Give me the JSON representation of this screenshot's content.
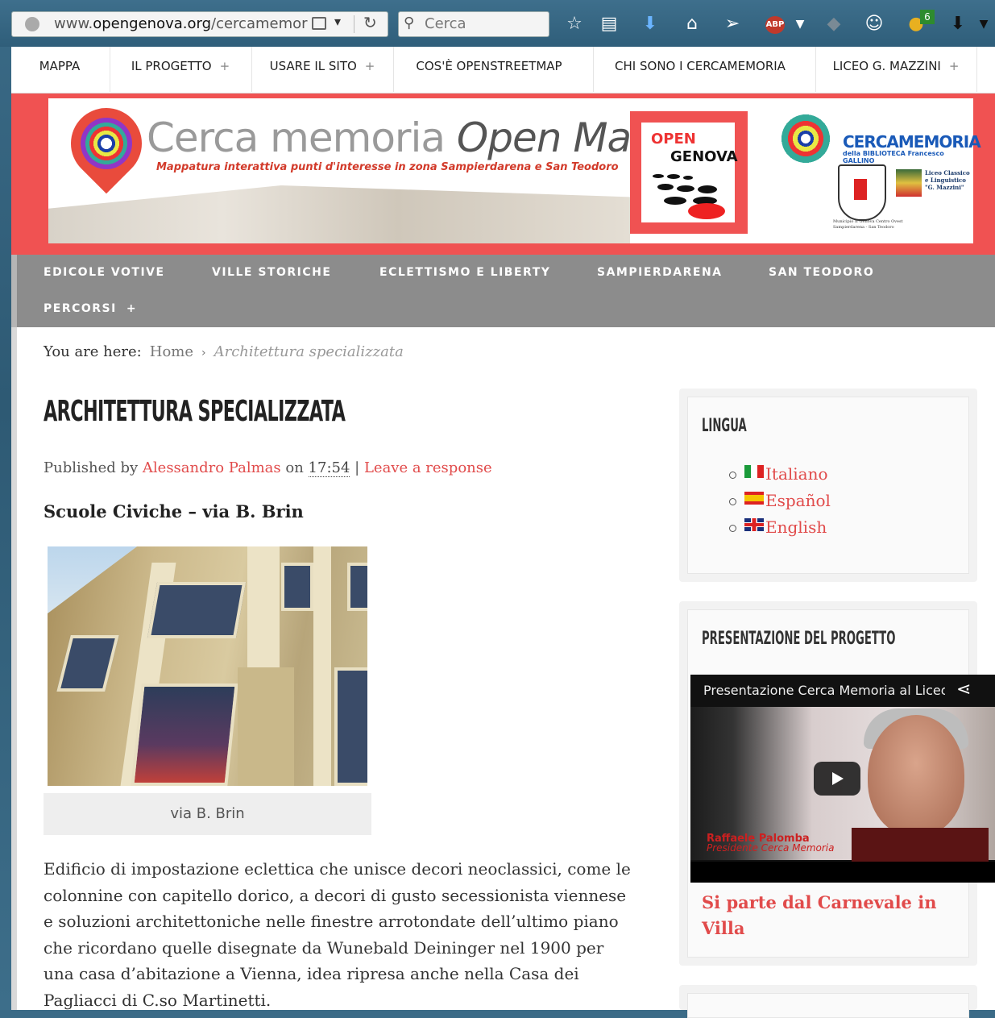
{
  "browser": {
    "url_prefix": "www.",
    "url_domain": "opengenova.org",
    "url_path": "/cercamemor",
    "search_placeholder": "Cerca",
    "abp_label": "ABP",
    "badge_count": "6"
  },
  "topnav": {
    "items": [
      {
        "label": "MAPPA",
        "plus": ""
      },
      {
        "label": "IL PROGETTO",
        "plus": "+"
      },
      {
        "label": "USARE IL SITO",
        "plus": "+"
      },
      {
        "label": "COS'È OPENSTREETMAP",
        "plus": ""
      },
      {
        "label": "CHI SONO I CERCAMEMORIA",
        "plus": ""
      },
      {
        "label": "LICEO G. MAZZINI",
        "plus": "+"
      }
    ]
  },
  "banner": {
    "title_a": "Cerca memoria ",
    "title_b": "Open Map",
    "subtitle": "Mappatura interattiva punti d'interesse in zona Sampierdarena e San Teodoro",
    "og_open": "OPEN",
    "og_genova": "GENOVA",
    "cm_name": "CERCAMEMORIA",
    "cm_sub": "della BIBLIOTECA Francesco GALLINO",
    "liceo_line1": "Liceo Classico",
    "liceo_line2": "e Linguistico",
    "liceo_line3": "\"G. Mazzini\"",
    "municipio_line1": "Municipio II Genova Centro Ovest",
    "municipio_line2": "Sampierdarena - San Teodoro"
  },
  "graynav": {
    "items": [
      "EDICOLE VOTIVE",
      "VILLE STORICHE",
      "ECLETTISMO E LIBERTY",
      "SAMPIERDARENA",
      "SAN TEODORO"
    ],
    "percorsi": "PERCORSI",
    "percorsi_plus": "+"
  },
  "breadcrumb": {
    "prefix": "You are here:",
    "home": "Home",
    "separator": "›",
    "current": "Architettura specializzata"
  },
  "article": {
    "title": "ARCHITETTURA SPECIALIZZATA",
    "published_by": "Published by",
    "author": "Alessandro Palmas",
    "on": "on",
    "time": "17:54",
    "pipe": "|",
    "leave_response": "Leave a response",
    "subheading": "Scuole Civiche – via B. Brin",
    "caption": "via B. Brin",
    "body": "Edificio di impostazione eclettica che unisce decori neoclassici, come le colonnine con capitello dorico, a decori di gusto secessionista viennese e soluzioni architettoniche nelle finestre arrotondate dell’ultimo piano che ricordano quelle disegnate da Wunebald Deininger nel 1900 per una casa d’abitazione a Vienna, idea ripresa anche nella Casa dei Pagliacci di C.so Martinetti."
  },
  "sidebar": {
    "lingua_title": "LINGUA",
    "languages": [
      {
        "label": "Italiano"
      },
      {
        "label": "Español"
      },
      {
        "label": "English"
      }
    ],
    "presentazione_title": "PRESENTAZIONE DEL PROGETTO",
    "video_title": "Presentazione Cerca Memoria al Liceo",
    "video_name": "Raffaele Palomba",
    "video_role": "Presidente Cerca Memoria",
    "post_link": "Si parte dal Carnevale in Villa"
  }
}
